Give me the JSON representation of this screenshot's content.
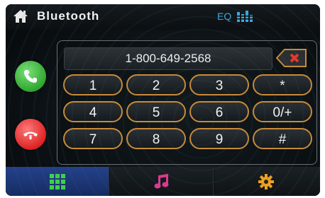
{
  "header": {
    "title": "Bluetooth",
    "eq_label": "EQ",
    "icons": [
      "home-icon",
      "equalizer-icon"
    ]
  },
  "display": {
    "number": "1-800-649-2568"
  },
  "keypad": {
    "rows": [
      [
        "1",
        "2",
        "3",
        "*"
      ],
      [
        "4",
        "5",
        "6",
        "0/+"
      ],
      [
        "7",
        "8",
        "9",
        "#"
      ]
    ]
  },
  "side_buttons": [
    "call-icon",
    "hang-up-icon"
  ],
  "bottom_tabs": [
    "keypad-grid-icon",
    "music-note-icon",
    "settings-gear-icon"
  ],
  "colors": {
    "key_border": "#c98a3a",
    "eq_accent": "#3aa9e0",
    "call_green": "#2fa82f",
    "end_red": "#e02222",
    "active_tab": "#24418a",
    "music_icon": "#d93b8e",
    "gear_icon": "#f0a020",
    "grid_icon": "#3fd14a"
  }
}
